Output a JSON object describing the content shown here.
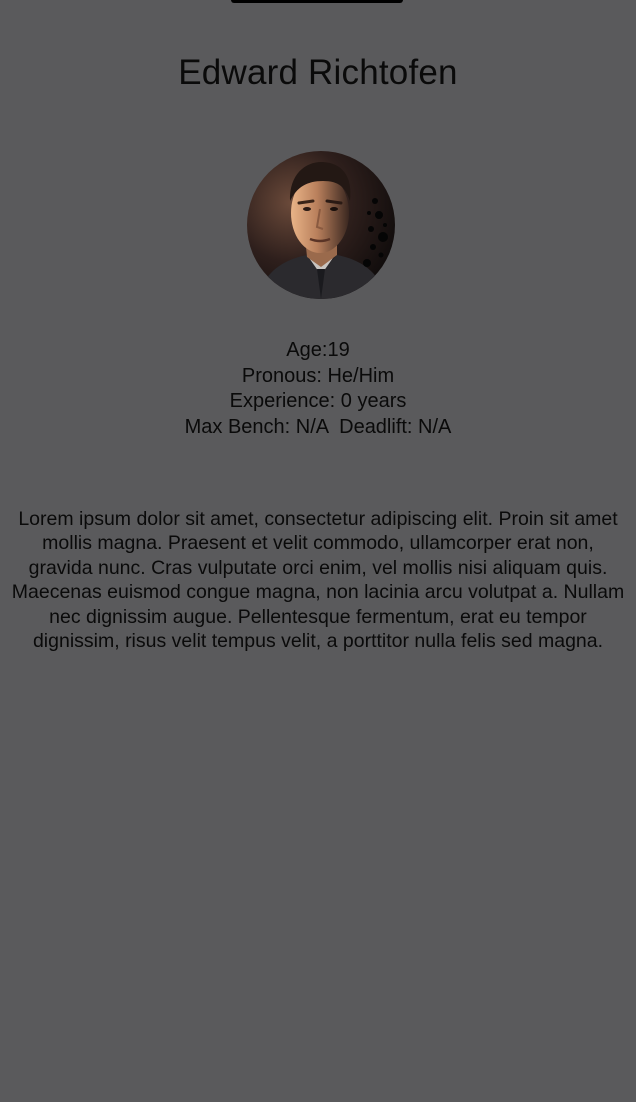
{
  "profile": {
    "name": "Edward Richtofen",
    "avatar_icon": "profile-photo-man",
    "stats": {
      "age": "Age:19",
      "pronouns": "Pronous: He/Him",
      "experience": "Experience: 0 years",
      "lifts": "Max Bench: N/A  Deadlift: N/A"
    },
    "bio": "Lorem ipsum dolor sit amet, consectetur adipiscing elit. Proin sit amet mollis magna. Praesent et velit commodo, ullamcorper erat non, gravida nunc. Cras vulputate orci enim, vel mollis nisi aliquam quis. Maecenas euismod congue magna, non lacinia arcu volutpat a. Nullam nec dignissim augue. Pellentesque fermentum, erat eu tempor dignissim, risus velit tempus velit, a porttitor nulla felis sed magna."
  },
  "colors": {
    "background": "#5a5a5c",
    "text": "#0a0a0a"
  }
}
